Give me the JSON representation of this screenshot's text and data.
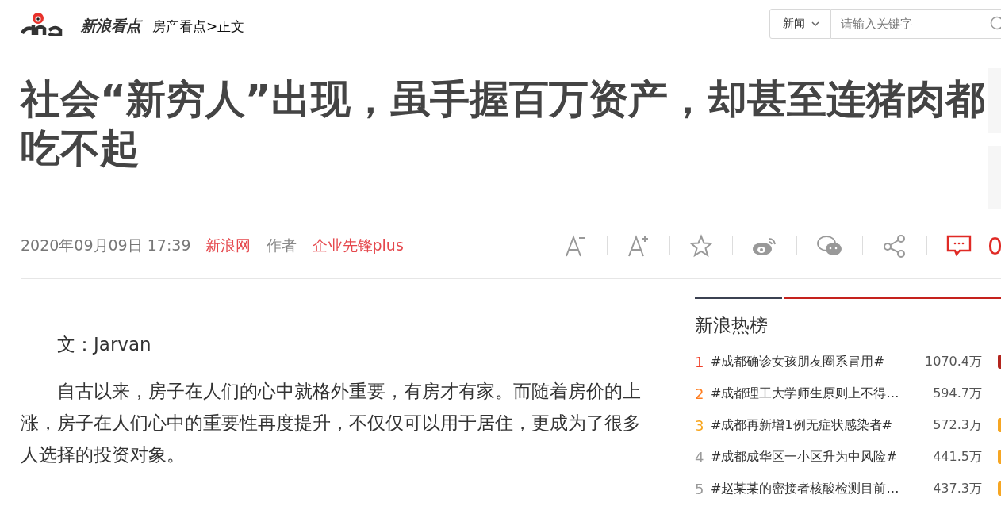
{
  "header": {
    "logo_text": "新浪看点",
    "breadcrumb": "房产看点>正文",
    "search": {
      "category": "新闻",
      "placeholder": "请输入关键字"
    }
  },
  "article": {
    "title": "社会“新穷人”出现，虽手握百万资产，却甚至连猪肉都吃不起",
    "meta": {
      "date": "2020年09月09日 17:39",
      "source": "新浪网",
      "author_label": "作者",
      "author": "企业先锋plus",
      "comment_count": "0"
    },
    "paragraphs": [
      "文：Jarvan",
      "自古以来，房子在人们的心中就格外重要，有房才有家。而随着房价的上涨，房子在人们心中的重要性再度提升，不仅仅可以用于居住，更成为了很多人选择的投资对象。"
    ]
  },
  "hot_list": {
    "title": "新浪热榜",
    "items": [
      {
        "rank": "1",
        "color": "#f0412a",
        "text": "#成都确诊女孩朋友圈系冒用#",
        "count": "1070.4万",
        "badge": {
          "color": "#b3251e"
        }
      },
      {
        "rank": "2",
        "color": "#ff7d1f",
        "text": "#成都理工大学师生原则上不得…",
        "count": "594.7万"
      },
      {
        "rank": "3",
        "color": "#f8a51c",
        "text": "#成都再新增1例无症状感染者#",
        "count": "572.3万",
        "badge": {
          "color": "#f6a623"
        }
      },
      {
        "rank": "4",
        "color": "#9a9a9a",
        "text": "#成都成华区一小区升为中风险#",
        "count": "441.5万",
        "badge": {
          "color": "#f6a623"
        }
      },
      {
        "rank": "5",
        "color": "#9a9a9a",
        "text": "#赵某某的密接者核酸检测目前…",
        "count": "437.3万",
        "badge": {
          "color": "#f6a623"
        }
      }
    ]
  }
}
